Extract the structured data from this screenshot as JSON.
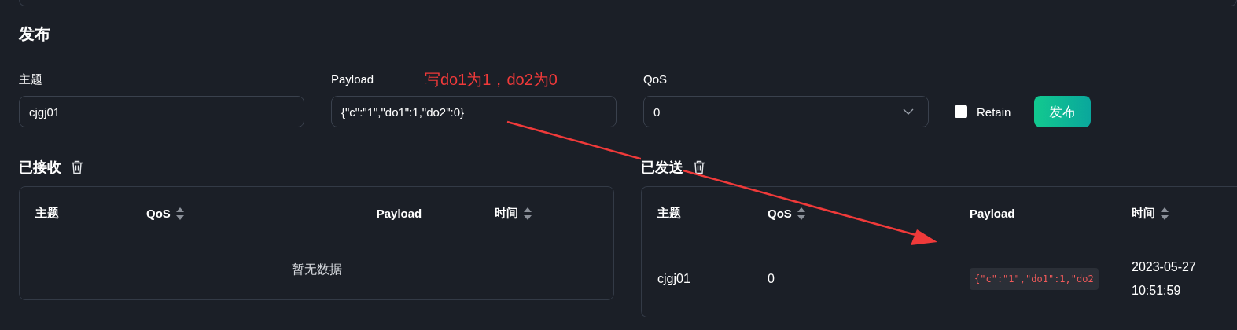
{
  "publish": {
    "title": "发布",
    "topic": {
      "label": "主题",
      "value": "cjgj01"
    },
    "payload": {
      "label": "Payload",
      "value": "{\"c\":\"1\",\"do1\":1,\"do2\":0}"
    },
    "qos": {
      "label": "QoS",
      "value": "0"
    },
    "retain": {
      "label": "Retain",
      "checked": false
    },
    "button": "发布"
  },
  "annotation": {
    "text": "写do1为1，do2为0"
  },
  "received": {
    "title": "已接收",
    "columns": [
      {
        "label": "主题",
        "sortable": false
      },
      {
        "label": "QoS",
        "sortable": true
      },
      {
        "label": "Payload",
        "sortable": false
      },
      {
        "label": "时间",
        "sortable": true
      }
    ],
    "empty_text": "暂无数据"
  },
  "sent": {
    "title": "已发送",
    "columns": [
      {
        "label": "主题",
        "sortable": false
      },
      {
        "label": "QoS",
        "sortable": true
      },
      {
        "label": "Payload",
        "sortable": false
      },
      {
        "label": "时间",
        "sortable": true
      }
    ],
    "rows": [
      {
        "topic": "cjgj01",
        "qos": "0",
        "payload": "{\"c\":\"1\",\"do1\":1,\"do2",
        "date": "2023-05-27",
        "time": "10:51:59"
      }
    ]
  }
}
